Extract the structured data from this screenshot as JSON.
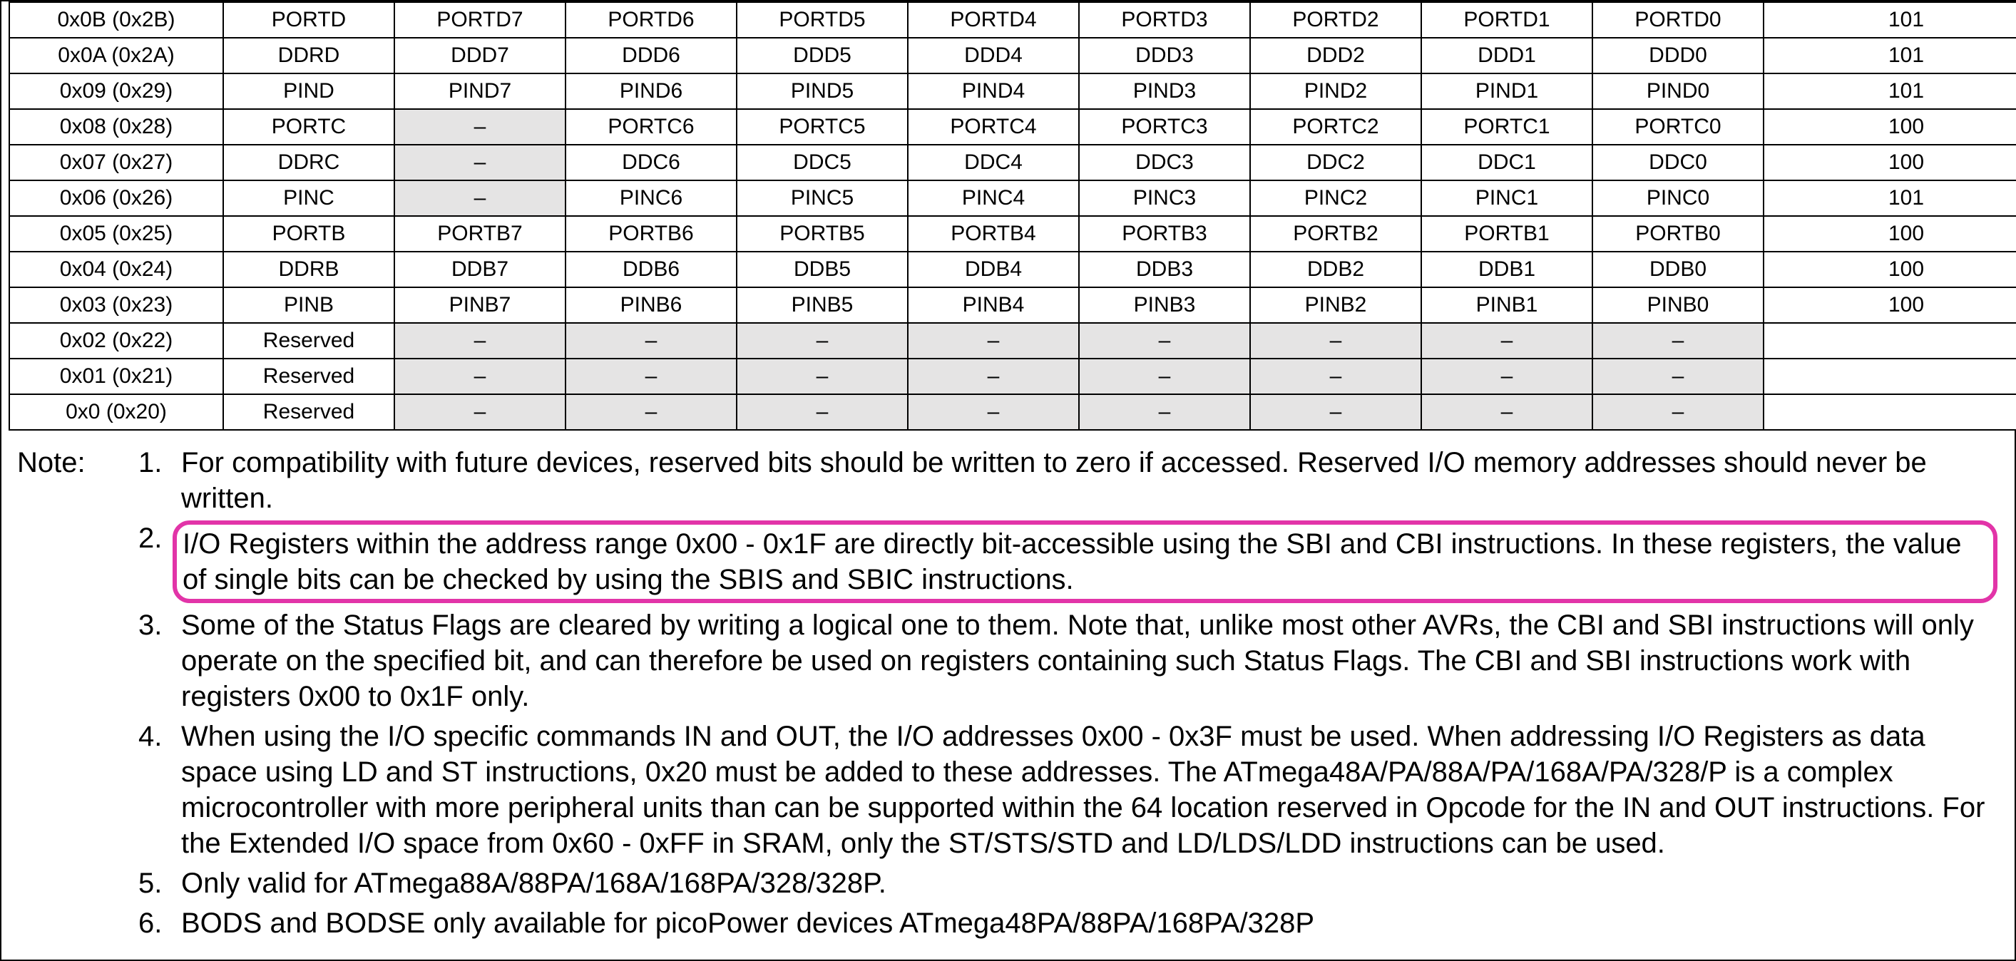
{
  "table": {
    "rows": [
      {
        "addr": "0x0B (0x2B)",
        "name": "PORTD",
        "bits": [
          "PORTD7",
          "PORTD6",
          "PORTD5",
          "PORTD4",
          "PORTD3",
          "PORTD2",
          "PORTD1",
          "PORTD0"
        ],
        "shaded": [
          false,
          false,
          false,
          false,
          false,
          false,
          false,
          false
        ],
        "page": "101"
      },
      {
        "addr": "0x0A (0x2A)",
        "name": "DDRD",
        "bits": [
          "DDD7",
          "DDD6",
          "DDD5",
          "DDD4",
          "DDD3",
          "DDD2",
          "DDD1",
          "DDD0"
        ],
        "shaded": [
          false,
          false,
          false,
          false,
          false,
          false,
          false,
          false
        ],
        "page": "101"
      },
      {
        "addr": "0x09 (0x29)",
        "name": "PIND",
        "bits": [
          "PIND7",
          "PIND6",
          "PIND5",
          "PIND4",
          "PIND3",
          "PIND2",
          "PIND1",
          "PIND0"
        ],
        "shaded": [
          false,
          false,
          false,
          false,
          false,
          false,
          false,
          false
        ],
        "page": "101"
      },
      {
        "addr": "0x08 (0x28)",
        "name": "PORTC",
        "bits": [
          "–",
          "PORTC6",
          "PORTC5",
          "PORTC4",
          "PORTC3",
          "PORTC2",
          "PORTC1",
          "PORTC0"
        ],
        "shaded": [
          true,
          false,
          false,
          false,
          false,
          false,
          false,
          false
        ],
        "page": "100"
      },
      {
        "addr": "0x07 (0x27)",
        "name": "DDRC",
        "bits": [
          "–",
          "DDC6",
          "DDC5",
          "DDC4",
          "DDC3",
          "DDC2",
          "DDC1",
          "DDC0"
        ],
        "shaded": [
          true,
          false,
          false,
          false,
          false,
          false,
          false,
          false
        ],
        "page": "100"
      },
      {
        "addr": "0x06 (0x26)",
        "name": "PINC",
        "bits": [
          "–",
          "PINC6",
          "PINC5",
          "PINC4",
          "PINC3",
          "PINC2",
          "PINC1",
          "PINC0"
        ],
        "shaded": [
          true,
          false,
          false,
          false,
          false,
          false,
          false,
          false
        ],
        "page": "101"
      },
      {
        "addr": "0x05 (0x25)",
        "name": "PORTB",
        "bits": [
          "PORTB7",
          "PORTB6",
          "PORTB5",
          "PORTB4",
          "PORTB3",
          "PORTB2",
          "PORTB1",
          "PORTB0"
        ],
        "shaded": [
          false,
          false,
          false,
          false,
          false,
          false,
          false,
          false
        ],
        "page": "100"
      },
      {
        "addr": "0x04 (0x24)",
        "name": "DDRB",
        "bits": [
          "DDB7",
          "DDB6",
          "DDB5",
          "DDB4",
          "DDB3",
          "DDB2",
          "DDB1",
          "DDB0"
        ],
        "shaded": [
          false,
          false,
          false,
          false,
          false,
          false,
          false,
          false
        ],
        "page": "100"
      },
      {
        "addr": "0x03 (0x23)",
        "name": "PINB",
        "bits": [
          "PINB7",
          "PINB6",
          "PINB5",
          "PINB4",
          "PINB3",
          "PINB2",
          "PINB1",
          "PINB0"
        ],
        "shaded": [
          false,
          false,
          false,
          false,
          false,
          false,
          false,
          false
        ],
        "page": "100"
      },
      {
        "addr": "0x02 (0x22)",
        "name": "Reserved",
        "bits": [
          "–",
          "–",
          "–",
          "–",
          "–",
          "–",
          "–",
          "–"
        ],
        "shaded": [
          true,
          true,
          true,
          true,
          true,
          true,
          true,
          true
        ],
        "page": ""
      },
      {
        "addr": "0x01 (0x21)",
        "name": "Reserved",
        "bits": [
          "–",
          "–",
          "–",
          "–",
          "–",
          "–",
          "–",
          "–"
        ],
        "shaded": [
          true,
          true,
          true,
          true,
          true,
          true,
          true,
          true
        ],
        "page": ""
      },
      {
        "addr": "0x0 (0x20)",
        "name": "Reserved",
        "bits": [
          "–",
          "–",
          "–",
          "–",
          "–",
          "–",
          "–",
          "–"
        ],
        "shaded": [
          true,
          true,
          true,
          true,
          true,
          true,
          true,
          true
        ],
        "page": ""
      }
    ]
  },
  "notes": {
    "label": "Note:",
    "items": [
      {
        "num": "1.",
        "text": "For compatibility with future devices, reserved bits should be written to zero if accessed. Reserved I/O memory addresses should never be written.",
        "highlight": false
      },
      {
        "num": "2.",
        "text": "I/O Registers within the address range 0x00 - 0x1F are directly bit-accessible using the SBI and CBI instructions. In these registers, the value of single bits can be checked by using the SBIS and SBIC instructions.",
        "highlight": true
      },
      {
        "num": "3.",
        "text": "Some of the Status Flags are cleared by writing a logical one to them. Note that, unlike most other AVRs, the CBI and SBI instructions will only operate on the specified bit, and can therefore be used on registers containing such Status Flags. The CBI and SBI instructions work with registers 0x00 to 0x1F only.",
        "highlight": false
      },
      {
        "num": "4.",
        "text": "When using the I/O specific commands IN and OUT, the I/O addresses 0x00 - 0x3F must be used. When addressing I/O Registers as data space using LD and ST instructions, 0x20 must be added to these addresses. The ATmega48A/PA/88A/PA/168A/PA/328/P is a complex microcontroller with more peripheral units than can be supported within the 64 location reserved in Opcode for the IN and OUT instructions. For the Extended I/O space from 0x60 - 0xFF in SRAM, only the ST/STS/STD and LD/LDS/LDD instructions can be used.",
        "highlight": false
      },
      {
        "num": "5.",
        "text": "Only valid for ATmega88A/88PA/168A/168PA/328/328P.",
        "highlight": false
      },
      {
        "num": "6.",
        "text": "BODS and BODSE only available for picoPower devices ATmega48PA/88PA/168PA/328P",
        "highlight": false
      }
    ]
  }
}
